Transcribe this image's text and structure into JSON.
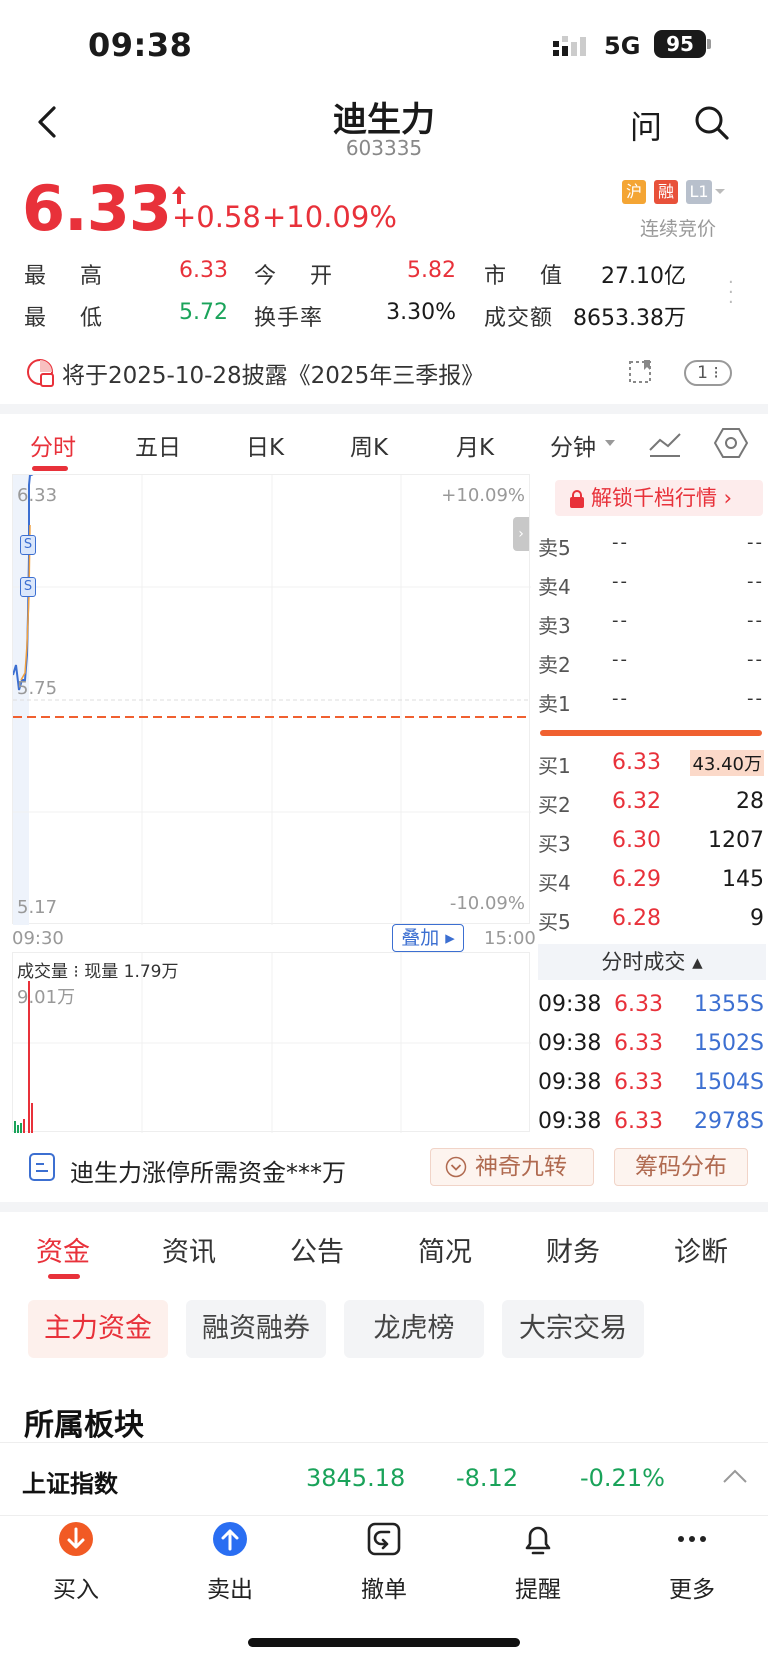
{
  "status_bar": {
    "time": "09:38",
    "network": "5G",
    "battery": "95"
  },
  "header": {
    "title": "迪生力",
    "code": "603335",
    "ask_label": "问"
  },
  "quote": {
    "price": "6.33",
    "change": "+0.58",
    "change_pct": "+10.09%",
    "badges": [
      "沪",
      "融",
      "L1"
    ],
    "market_status": "连续竞价",
    "stats": {
      "high_label": "最　高",
      "high": "6.33",
      "open_label": "今　开",
      "open": "5.82",
      "mcap_label": "市　值",
      "mcap": "27.10亿",
      "low_label": "最　低",
      "low": "5.72",
      "turnover_label": "换手率",
      "turnover": "3.30%",
      "amount_label": "成交额",
      "amount": "8653.38万"
    }
  },
  "notice": {
    "text": "将于2025-10-28披露《2025年三季报》",
    "count": "1"
  },
  "chart_tabs": [
    "分时",
    "五日",
    "日K",
    "周K",
    "月K",
    "分钟"
  ],
  "chart": {
    "y_top": "6.33",
    "y_mid": "5.75",
    "y_bottom": "5.17",
    "pct_top": "+10.09%",
    "pct_bottom": "-10.09%",
    "time_start": "09:30",
    "time_end": "15:00",
    "overlay_label": "叠加",
    "vol_title": "成交量",
    "vol_current": "现量 1.79万",
    "vol_max": "9.01万",
    "signal_label": "S",
    "colors": {
      "up": "#e8313a",
      "down": "#1aa35a",
      "line": "#3c6fd1",
      "avg": "#f0a040",
      "prev_close": "#f06030"
    }
  },
  "order_book": {
    "unlock_label": "解锁千档行情",
    "asks": [
      {
        "label": "卖5",
        "price": "--",
        "vol": "--"
      },
      {
        "label": "卖4",
        "price": "--",
        "vol": "--"
      },
      {
        "label": "卖3",
        "price": "--",
        "vol": "--"
      },
      {
        "label": "卖2",
        "price": "--",
        "vol": "--"
      },
      {
        "label": "卖1",
        "price": "--",
        "vol": "--"
      }
    ],
    "bids": [
      {
        "label": "买1",
        "price": "6.33",
        "vol": "43.40万"
      },
      {
        "label": "买2",
        "price": "6.32",
        "vol": "28"
      },
      {
        "label": "买3",
        "price": "6.30",
        "vol": "1207"
      },
      {
        "label": "买4",
        "price": "6.29",
        "vol": "145"
      },
      {
        "label": "买5",
        "price": "6.28",
        "vol": "9"
      }
    ],
    "ticks_title": "分时成交",
    "ticks": [
      {
        "time": "09:38",
        "price": "6.33",
        "vol": "1355S"
      },
      {
        "time": "09:38",
        "price": "6.33",
        "vol": "1502S"
      },
      {
        "time": "09:38",
        "price": "6.33",
        "vol": "1504S"
      },
      {
        "time": "09:38",
        "price": "6.33",
        "vol": "2978S"
      }
    ]
  },
  "promo": {
    "text": "迪生力涨停所需资金***万",
    "btn1": "神奇九转",
    "btn2": "筹码分布"
  },
  "section_tabs": [
    "资金",
    "资讯",
    "公告",
    "简况",
    "财务",
    "诊断"
  ],
  "pills": [
    "主力资金",
    "融资融券",
    "龙虎榜",
    "大宗交易"
  ],
  "sector": {
    "title": "所属板块",
    "name": "上证指数",
    "value": "3845.18",
    "change": "-8.12",
    "pct": "-0.21%"
  },
  "bottom_nav": [
    "买入",
    "卖出",
    "撤单",
    "提醒",
    "更多"
  ]
}
